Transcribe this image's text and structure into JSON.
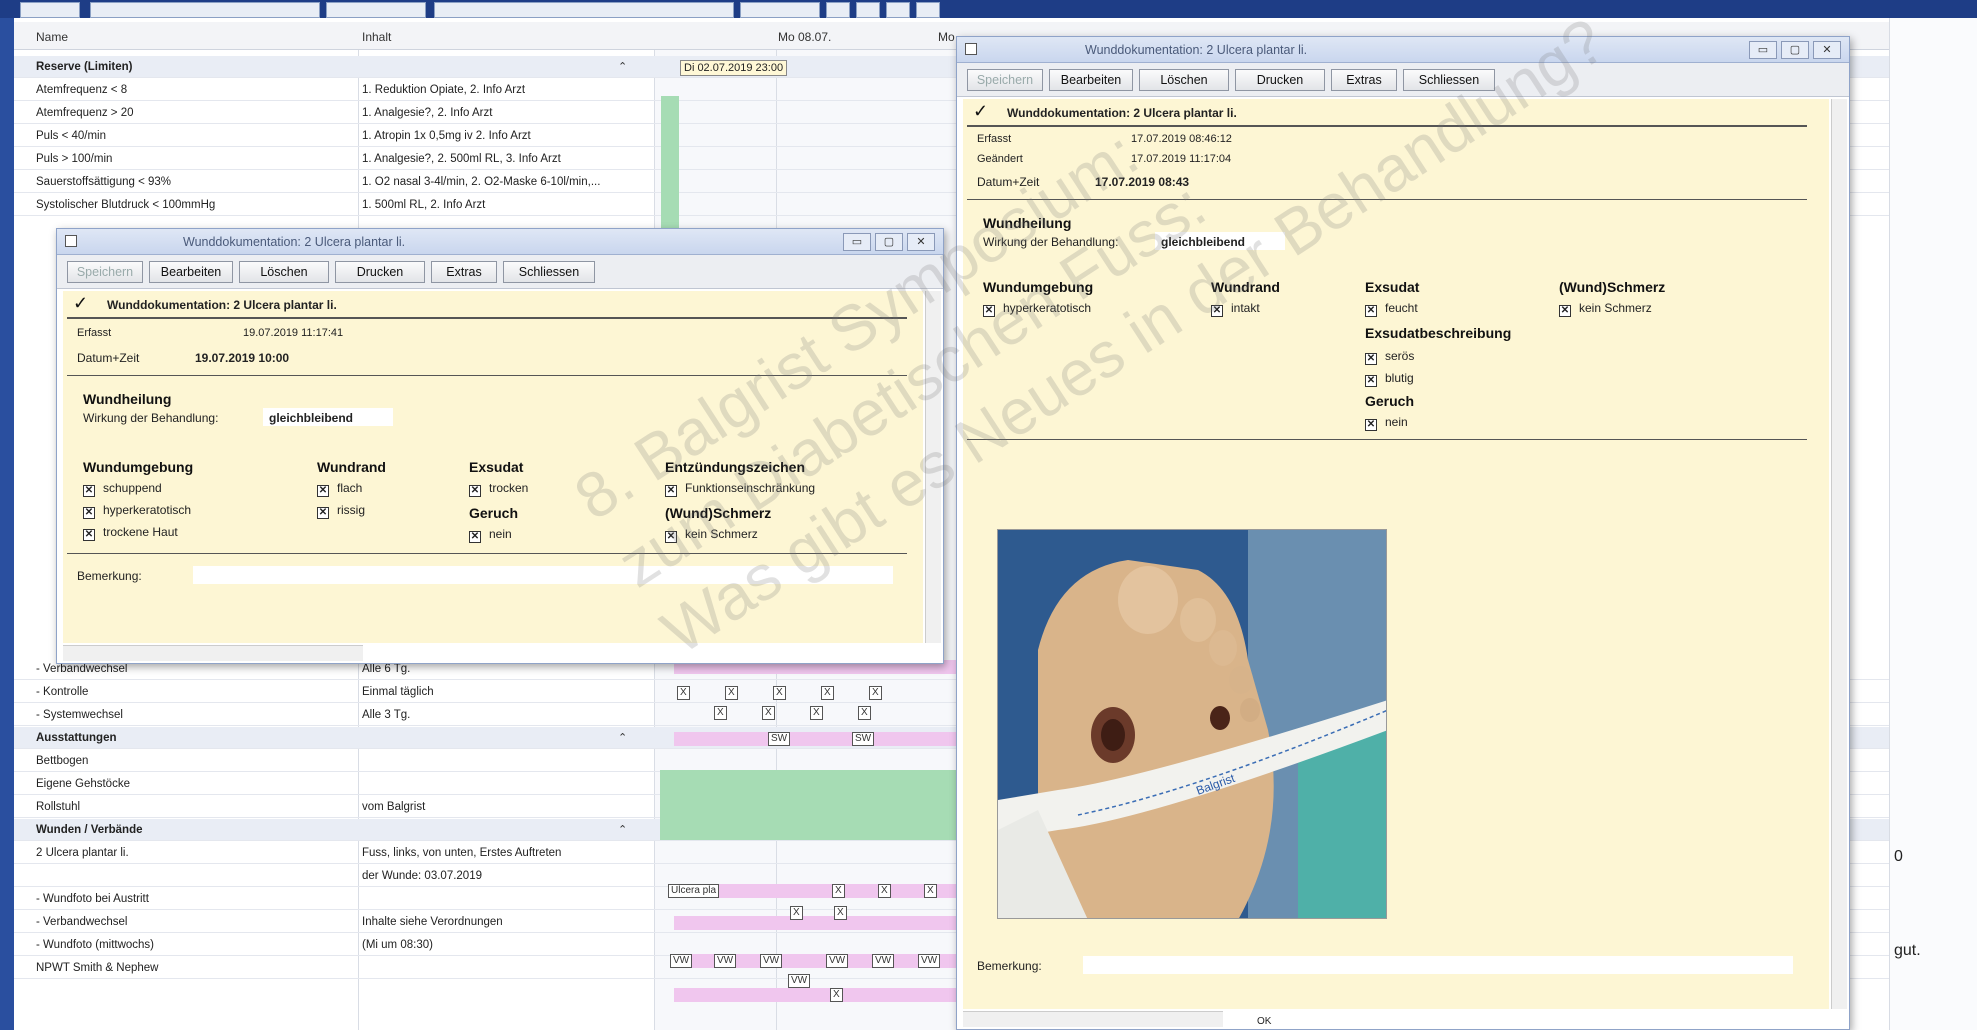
{
  "grid": {
    "col_name": "Name",
    "col_content": "Inhalt",
    "date1": "Mo 08.07.",
    "date2": "Mo",
    "timestamp_tag": "Di 02.07.2019 23:00"
  },
  "rows_top": [
    {
      "name": "Reserve (Limiten)",
      "content": "",
      "section": true
    },
    {
      "name": "Atemfrequenz < 8",
      "content": "1. Reduktion Opiate, 2. Info Arzt"
    },
    {
      "name": "Atemfrequenz > 20",
      "content": "1. Analgesie?, 2. Info Arzt"
    },
    {
      "name": "Puls < 40/min",
      "content": "1. Atropin 1x 0,5mg iv 2. Info Arzt"
    },
    {
      "name": "Puls > 100/min",
      "content": "1. Analgesie?, 2. 500ml RL, 3. Info Arzt"
    },
    {
      "name": "Sauerstoffsättigung < 93%",
      "content": "1. O2 nasal 3-4l/min, 2. O2-Maske 6-10l/min,..."
    },
    {
      "name": "Systolischer Blutdruck < 100mmHg",
      "content": "1. 500ml RL, 2. Info Arzt"
    }
  ],
  "rows_bottom": [
    {
      "name": "- Verbandwechsel",
      "content": "Alle 6 Tg."
    },
    {
      "name": "- Kontrolle",
      "content": "Einmal täglich"
    },
    {
      "name": "- Systemwechsel",
      "content": "Alle 3 Tg."
    },
    {
      "name": "Ausstattungen",
      "content": "",
      "section": true
    },
    {
      "name": "Bettbogen",
      "content": ""
    },
    {
      "name": "Eigene Gehstöcke",
      "content": ""
    },
    {
      "name": "Rollstuhl",
      "content": "vom Balgrist"
    },
    {
      "name": "Wunden / Verbände",
      "content": "",
      "section": true
    },
    {
      "name": "2 Ulcera plantar li.",
      "content": "Fuss, links, von unten, Erstes Auftreten"
    },
    {
      "name": "",
      "content": "der Wunde: 03.07.2019"
    },
    {
      "name": "- Wundfoto bei Austritt",
      "content": ""
    },
    {
      "name": "- Verbandwechsel",
      "content": "Inhalte siehe Verordnungen"
    },
    {
      "name": "- Wundfoto (mittwochs)",
      "content": "(Mi um 08:30)"
    },
    {
      "name": "NPWT Smith & Nephew",
      "content": ""
    }
  ],
  "marks": {
    "sw": "SW",
    "vw": "VW",
    "x": "X",
    "ulcera": "Ulcera pla"
  },
  "win1": {
    "title": "Wunddokumentation: 2 Ulcera plantar li.",
    "buttons": [
      "Speichern",
      "Bearbeiten",
      "Löschen",
      "Drucken",
      "Extras",
      "Schliessen"
    ],
    "heading": "Wunddokumentation: 2 Ulcera plantar li.",
    "erfasst_label": "Erfasst",
    "erfasst_value": "19.07.2019 11:17:41",
    "datum_label": "Datum+Zeit",
    "datum_value": "19.07.2019 10:00",
    "wundheilung": "Wundheilung",
    "wirkung_label": "Wirkung der Behandlung:",
    "wirkung_value": "gleichbleibend",
    "h_umgebung": "Wundumgebung",
    "h_rand": "Wundrand",
    "h_exsudat": "Exsudat",
    "h_entz": "Entzündungszeichen",
    "umgebung": [
      "schuppend",
      "hyperkeratotisch",
      "trockene Haut"
    ],
    "rand": [
      "flach",
      "rissig"
    ],
    "exsudat": [
      "trocken"
    ],
    "h_geruch": "Geruch",
    "geruch": [
      "nein"
    ],
    "entz": [
      "Funktionseinschränkung"
    ],
    "h_schmerz": "(Wund)Schmerz",
    "schmerz": [
      "kein Schmerz"
    ],
    "bemerkung": "Bemerkung:"
  },
  "win2": {
    "title": "Wunddokumentation: 2 Ulcera plantar li.",
    "buttons": [
      "Speichern",
      "Bearbeiten",
      "Löschen",
      "Drucken",
      "Extras",
      "Schliessen"
    ],
    "heading": "Wunddokumentation: 2 Ulcera plantar li.",
    "erfasst_label": "Erfasst",
    "erfasst_value": "17.07.2019 08:46:12",
    "geaendert_label": "Geändert",
    "geaendert_value": "17.07.2019 11:17:04",
    "datum_label": "Datum+Zeit",
    "datum_value": "17.07.2019 08:43",
    "wundheilung": "Wundheilung",
    "wirkung_label": "Wirkung der Behandlung:",
    "wirkung_value": "gleichbleibend",
    "h_umgebung": "Wundumgebung",
    "h_rand": "Wundrand",
    "h_exsudat": "Exsudat",
    "h_schmerz": "(Wund)Schmerz",
    "umgebung": [
      "hyperkeratotisch"
    ],
    "rand": [
      "intakt"
    ],
    "exsudat": [
      "feucht"
    ],
    "schmerz": [
      "kein Schmerz"
    ],
    "h_exsbeschr": "Exsudatbeschreibung",
    "exsbeschr": [
      "serös",
      "blutig"
    ],
    "h_geruch": "Geruch",
    "geruch": [
      "nein"
    ],
    "photo_tape_text": "Balgrist",
    "bemerkung": "Bemerkung:",
    "ok": "OK"
  },
  "watermark": [
    "8. Balgrist Symposium:",
    "zum Diabetischen Fuss:",
    "Was gibt es Neues in der Behandlung?"
  ],
  "right_gutter": {
    "val1": "0",
    "val2": "gut."
  },
  "colors": {
    "accent": "#1f3f86",
    "panel": "#fdf6d4",
    "green": "#a6dcb4",
    "pink": "#f0c6ee"
  }
}
